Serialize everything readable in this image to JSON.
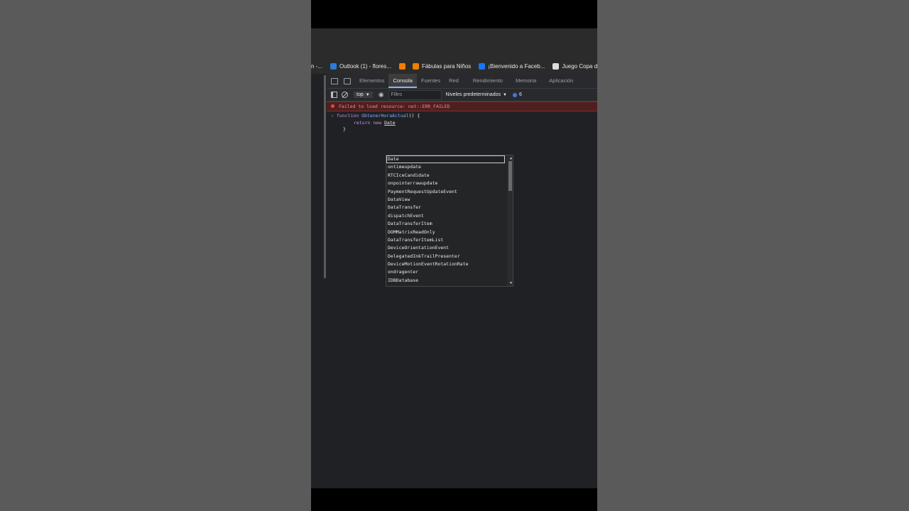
{
  "bookmarks": [
    {
      "label": "n -...",
      "icon": "none"
    },
    {
      "label": "Outlook (1) - flores...",
      "icon": "outlook-icon"
    },
    {
      "label": "",
      "icon": "blogger-icon"
    },
    {
      "label": "Fábulas para Niños",
      "icon": "blogger-icon"
    },
    {
      "label": "¡Bienvenido a Faceb...",
      "icon": "facebook-icon"
    },
    {
      "label": "Juego Copa del Mu",
      "icon": "page-icon"
    }
  ],
  "devtools": {
    "tabs": [
      "Elementos",
      "Consola",
      "Fuentes",
      "Red",
      "Rendimiento",
      "Memoria",
      "Aplicación"
    ],
    "active_tab": "Consola",
    "toolbar": {
      "context": "top",
      "filter_placeholder": "Filtro",
      "levels": "Niveles predeterminados",
      "issues_count": "6"
    },
    "error_message": "Failed to load resource: net::ERR_FAILED",
    "code": {
      "line1_kw": "function",
      "line1_name": "ObtenerHoraActual",
      "line1_rest": "() {",
      "line2_kw": "return new",
      "line2_typed": "Date",
      "line3": "}"
    },
    "autocomplete": [
      "Date",
      "ontimeupdate",
      "RTCIceCandidate",
      "onpointerrawupdate",
      "PaymentRequestUpdateEvent",
      "DataView",
      "DataTransfer",
      "dispatchEvent",
      "DataTransferItem",
      "DOMMatrixReadOnly",
      "DataTransferItemList",
      "DeviceOrientationEvent",
      "DelegatedInkTrailPresenter",
      "DeviceMotionEventRotationRate",
      "ondragenter",
      "IDBDatabase"
    ]
  },
  "colors": {
    "accent": "#8ab4f8",
    "error": "#f28b82",
    "background": "#202124"
  }
}
